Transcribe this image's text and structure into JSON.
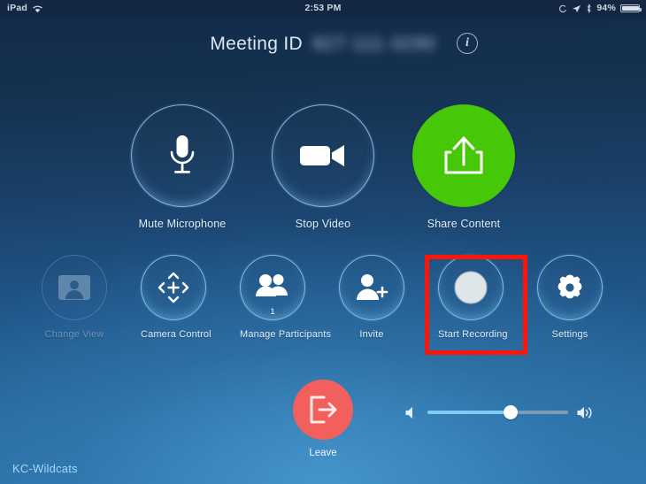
{
  "status_bar": {
    "device": "iPad",
    "wifi_icon": "wifi-icon",
    "time": "2:53 PM",
    "rotation_lock_icon": "rotation-lock-icon",
    "location_icon": "location-arrow-icon",
    "bluetooth_icon": "bluetooth-icon",
    "battery_percent": "94%",
    "battery_icon": "battery-icon"
  },
  "header": {
    "meeting_label": "Meeting ID",
    "meeting_id": "927-111-3290",
    "meeting_id_redacted": true,
    "info_icon": "info-icon",
    "info_glyph": "i"
  },
  "controls": {
    "row1": [
      {
        "id": "mute-microphone",
        "label": "Mute Microphone",
        "icon": "microphone-icon",
        "style": "ring",
        "enabled": true
      },
      {
        "id": "stop-video",
        "label": "Stop Video",
        "icon": "video-camera-icon",
        "style": "ring",
        "enabled": true
      },
      {
        "id": "share-content",
        "label": "Share Content",
        "icon": "share-upload-icon",
        "style": "green",
        "enabled": true
      }
    ],
    "row2": [
      {
        "id": "change-view",
        "label": "Change View",
        "icon": "person-card-icon",
        "style": "ring",
        "enabled": false
      },
      {
        "id": "camera-control",
        "label": "Camera Control",
        "icon": "dpad-icon",
        "style": "ring",
        "enabled": true
      },
      {
        "id": "manage-participants",
        "label": "Manage Participants",
        "icon": "people-icon",
        "style": "ring",
        "enabled": true,
        "badge": "1"
      },
      {
        "id": "invite",
        "label": "Invite",
        "icon": "person-plus-icon",
        "style": "ring",
        "enabled": true
      },
      {
        "id": "start-recording",
        "label": "Start Recording",
        "icon": "record-button-icon",
        "style": "ring",
        "enabled": true,
        "highlighted": true
      },
      {
        "id": "settings",
        "label": "Settings",
        "icon": "gear-icon",
        "style": "ring",
        "enabled": true
      }
    ]
  },
  "leave": {
    "label": "Leave",
    "icon": "exit-door-icon",
    "color": "#f2605e"
  },
  "volume": {
    "low_icon": "speaker-mute-icon",
    "high_icon": "speaker-loud-icon",
    "level_percent": 59
  },
  "footer": {
    "account_name": "KC-Wildcats"
  },
  "annotation": {
    "type": "highlight-box",
    "color": "#fb1607",
    "targets": "start-recording"
  },
  "colors": {
    "accent_green": "#46c708",
    "leave_red": "#f2605e",
    "highlight_red": "#fb1607",
    "ring_blue": "#96cdf0",
    "footer_blue": "#a8d8f5"
  }
}
